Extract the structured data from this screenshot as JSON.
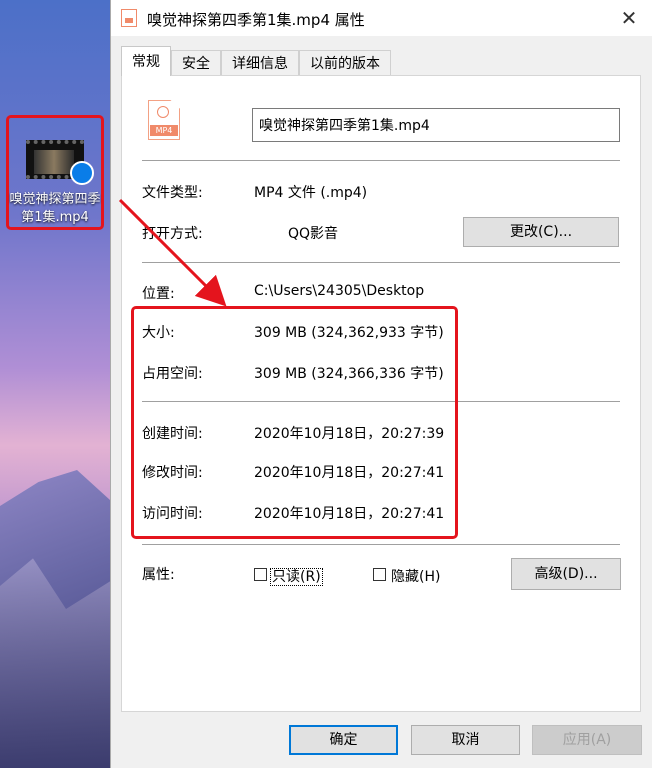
{
  "desktop": {
    "icon_label": "嗅觉神探第四季第1集.mp4"
  },
  "window": {
    "title": "嗅觉神探第四季第1集.mp4 属性",
    "close_glyph": "✕"
  },
  "tabs": [
    {
      "label": "常规",
      "active": true
    },
    {
      "label": "安全",
      "active": false
    },
    {
      "label": "详细信息",
      "active": false
    },
    {
      "label": "以前的版本",
      "active": false
    }
  ],
  "general": {
    "file_icon_text": "MP4",
    "file_name": "嗅觉神探第四季第1集.mp4",
    "file_type_label": "文件类型:",
    "file_type_value": "MP4 文件 (.mp4)",
    "open_with_label": "打开方式:",
    "open_with_value": "QQ影音",
    "change_button": "更改(C)...",
    "location_label": "位置:",
    "location_value": "C:\\Users\\24305\\Desktop",
    "size_label": "大小:",
    "size_value": "309 MB (324,362,933 字节)",
    "size_on_disk_label": "占用空间:",
    "size_on_disk_value": "309 MB (324,366,336 字节)",
    "created_label": "创建时间:",
    "created_value": "2020年10月18日，20:27:39",
    "modified_label": "修改时间:",
    "modified_value": "2020年10月18日，20:27:41",
    "accessed_label": "访问时间:",
    "accessed_value": "2020年10月18日，20:27:41",
    "attributes_label": "属性:",
    "readonly_label": "只读(R)",
    "hidden_label": "隐藏(H)",
    "advanced_button": "高级(D)..."
  },
  "footer": {
    "ok_button": "确定",
    "cancel_button": "取消",
    "apply_button": "应用(A)"
  },
  "colors": {
    "annotation": "#e4141d",
    "focus_border": "#0078d7"
  }
}
